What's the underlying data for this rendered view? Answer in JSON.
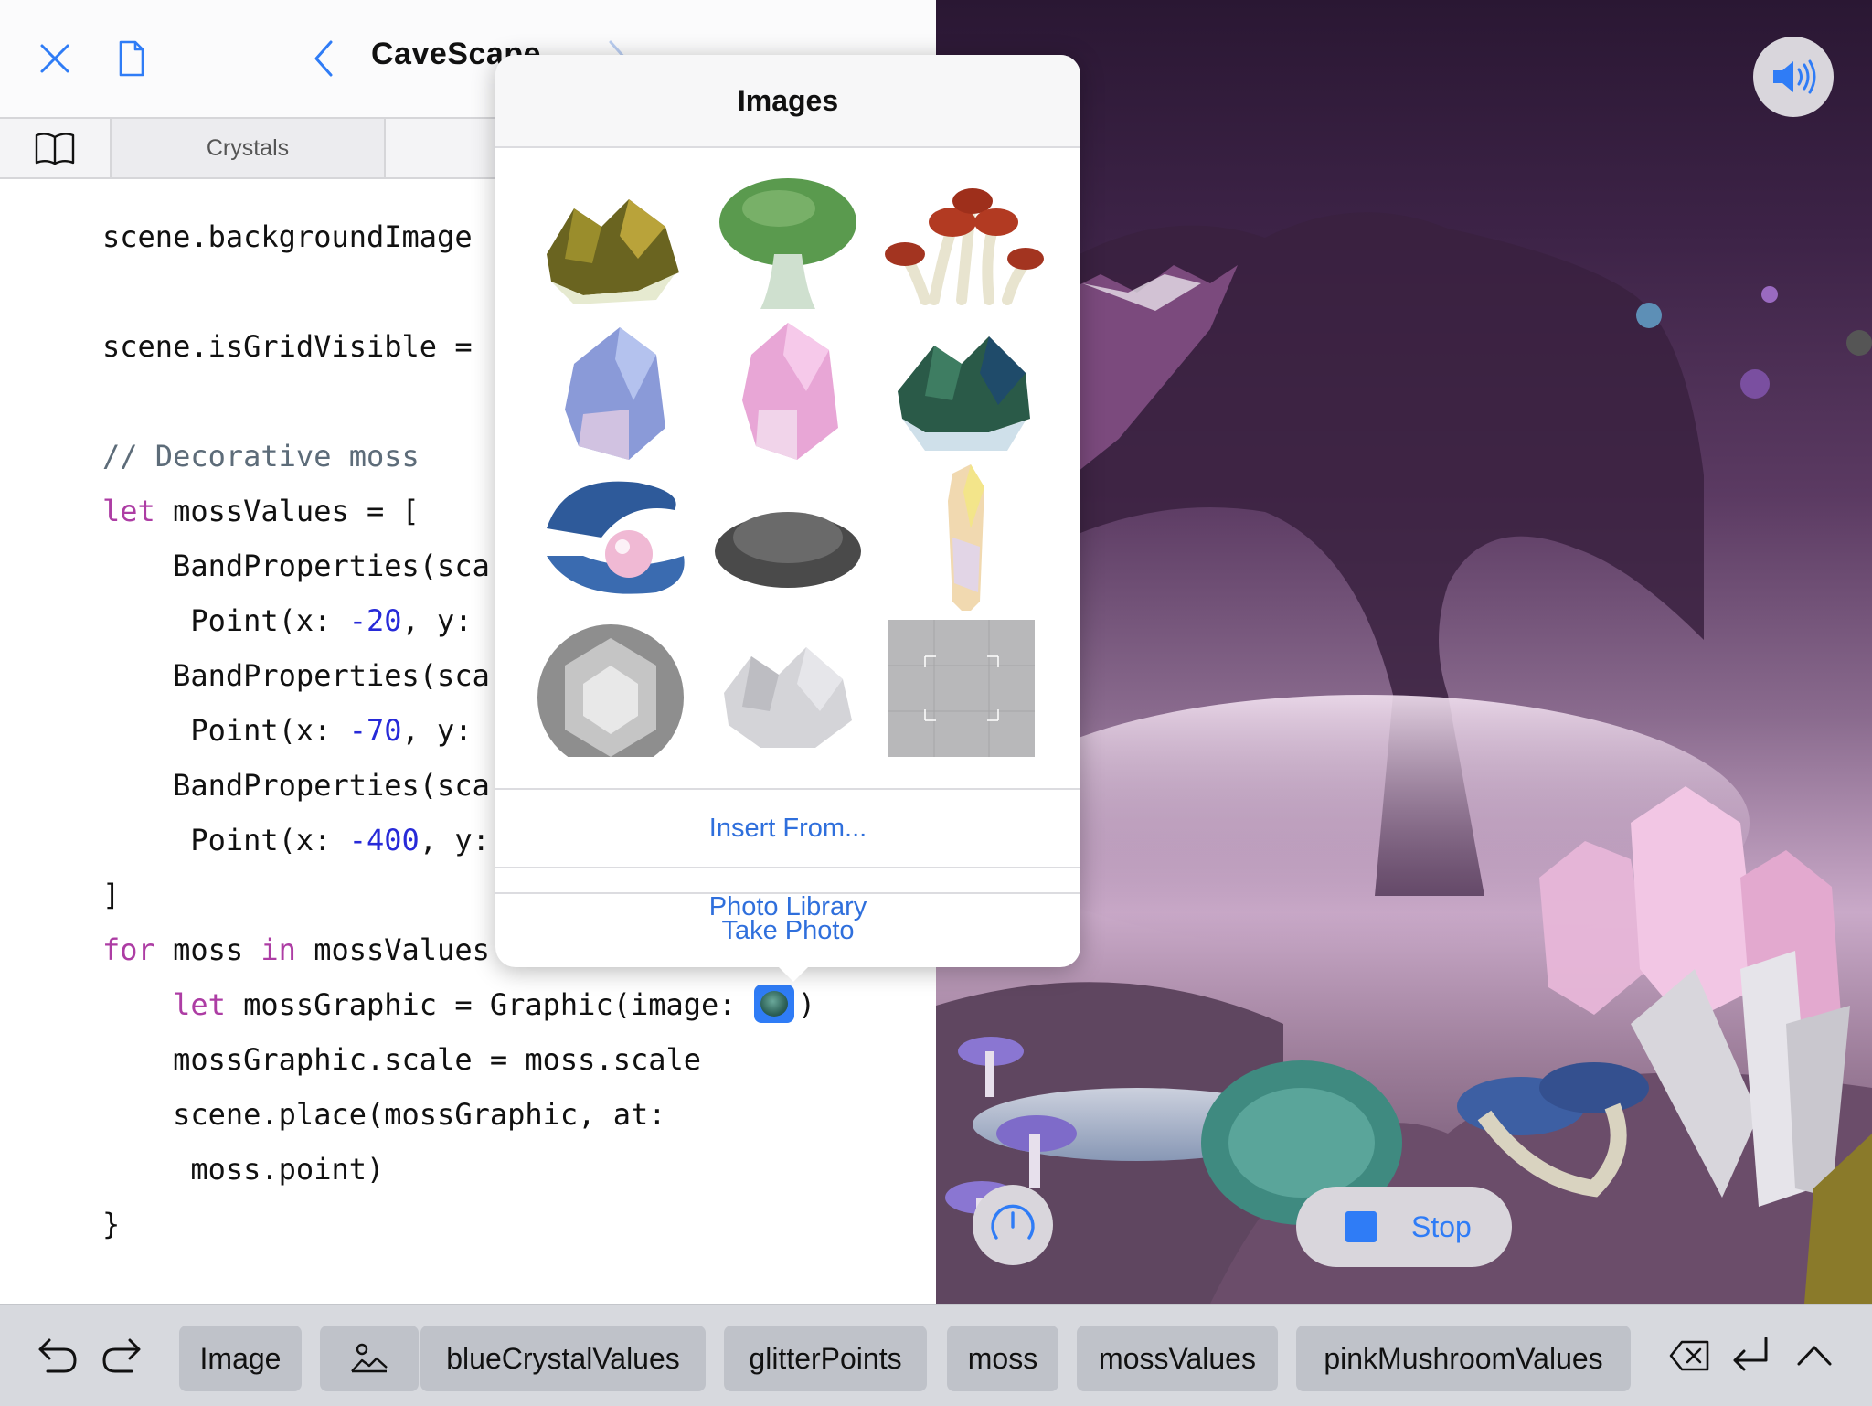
{
  "nav": {
    "title": "CaveScape",
    "icons": [
      "close-icon",
      "document-icon",
      "back-chevron-icon",
      "forward-chevron-icon",
      "more-icon"
    ]
  },
  "tabs": [
    "Crystals",
    ""
  ],
  "code": {
    "line1": "scene.backgroundImage",
    "line2": "scene.isGridVisible =",
    "line3": "// Decorative moss",
    "line4_kw": "let",
    "line4_rest": " mossValues = [",
    "line5": "    BandProperties(sca",
    "line6_a": "     Point(x: ",
    "line6_num": "-20",
    "line6_b": ", y:",
    "line7": "    BandProperties(sca",
    "line8_a": "     Point(x: ",
    "line8_num": "-70",
    "line8_b": ", y:",
    "line9": "    BandProperties(sca",
    "line10_a": "     Point(x: ",
    "line10_num": "-400",
    "line10_b": ", y:",
    "line11": "]",
    "line12_kw1": "for",
    "line12_mid": " moss ",
    "line12_kw2": "in",
    "line12_rest": " mossValues",
    "line13_kw": "    let",
    "line13_rest": " mossGraphic = Graphic(image: ",
    "line13_end": ")",
    "line14": "    mossGraphic.scale = moss.scale",
    "line15": "    scene.place(mossGraphic, at:",
    "line16": "     moss.point)",
    "line17": "}"
  },
  "popover": {
    "title": "Images",
    "images": [
      "yellow-crystal-cluster",
      "green-mushroom",
      "red-mushroom-cluster",
      "blue-crystal",
      "pink-crystal",
      "green-crystal-cluster",
      "blue-clam-shell-pearl",
      "gray-moss",
      "opal-crystal-shard",
      "gray-gem",
      "white-crystal-cluster",
      "gray-grid-placeholder"
    ],
    "actions": [
      "Insert From...",
      "Photo Library",
      "Take Photo"
    ]
  },
  "live_view": {
    "stop_label": "Stop",
    "accent": "#2f7cf6"
  },
  "shortcuts": {
    "chips": [
      "Image",
      "blueCrystalValues",
      "glitterPoints",
      "moss",
      "mossValues",
      "pinkMushroomValues"
    ]
  }
}
